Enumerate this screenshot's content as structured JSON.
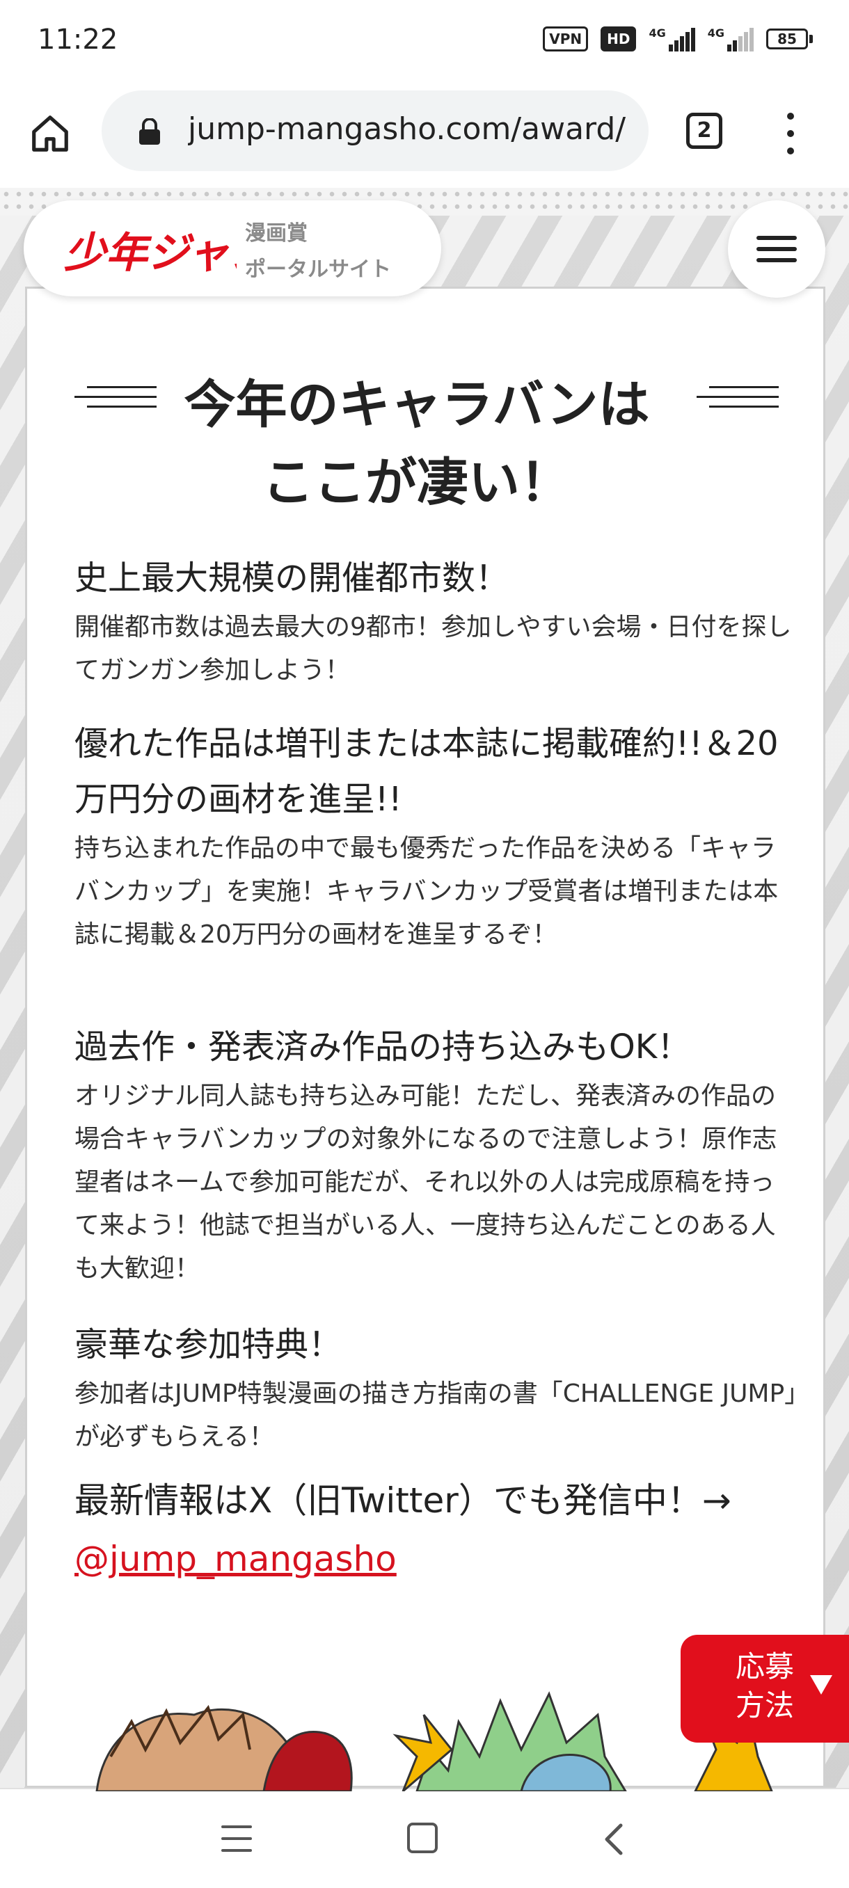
{
  "status_bar": {
    "time": "11:22",
    "badges": [
      "VPN",
      "HD"
    ],
    "network": [
      "4G",
      "4G"
    ],
    "battery": "85",
    "icons": [
      "vpn-icon",
      "hd-icon",
      "signal-icon",
      "signal-icon",
      "battery-icon"
    ]
  },
  "browser": {
    "url": "jump-mangasho.com/award/",
    "tab_count": "2",
    "icons": [
      "home-icon",
      "lock-icon",
      "tabs-icon",
      "more-vert-icon"
    ]
  },
  "header": {
    "logo_text": "少年ジャンプ",
    "subtitle_line1": "漫画賞",
    "subtitle_line2": "ポータルサイト",
    "menu_icon": "hamburger-icon"
  },
  "content": {
    "heading_line1": "今年のキャラバンは",
    "heading_line2": "ここが凄い！",
    "features": [
      {
        "title": "史上最大規模の開催都市数！",
        "description": "開催都市数は過去最大の9都市！参加しやすい会場・日付を探してガンガン参加しよう！"
      },
      {
        "title": "優れた作品は増刊または本誌に掲載確約!!＆20万円分の画材を進呈!!",
        "description": "持ち込まれた作品の中で最も優秀だった作品を決める「キャラバンカップ」を実施！キャラバンカップ受賞者は増刊または本誌に掲載＆20万円分の画材を進呈するぞ！"
      },
      {
        "title": "過去作・発表済み作品の持ち込みもOK！",
        "description": "オリジナル同人誌も持ち込み可能！ただし、発表済みの作品の場合キャラバンカップの対象外になるので注意しよう！原作志望者はネームで参加可能だが、それ以外の人は完成原稿を持って来よう！他誌で担当がいる人、一度持ち込んだことのある人も大歓迎！"
      },
      {
        "title": "豪華な参加特典！",
        "description": "参加者はJUMP特製漫画の描き方指南の書「CHALLENGE JUMP」が必ずもらえる！"
      }
    ],
    "x_notice": "最新情報はX（旧Twitter）でも発信中！→",
    "x_handle": "@jump_mangasho"
  },
  "apply_tab": {
    "label": "応募方法",
    "icon": "triangle-down-icon"
  },
  "nav_bar": {
    "icons": [
      "recents-icon",
      "home-square-icon",
      "back-icon"
    ]
  },
  "colors": {
    "brand_red": "#e10f1c",
    "link_red": "#d6121f",
    "battery_yellow": "#f2c200"
  }
}
